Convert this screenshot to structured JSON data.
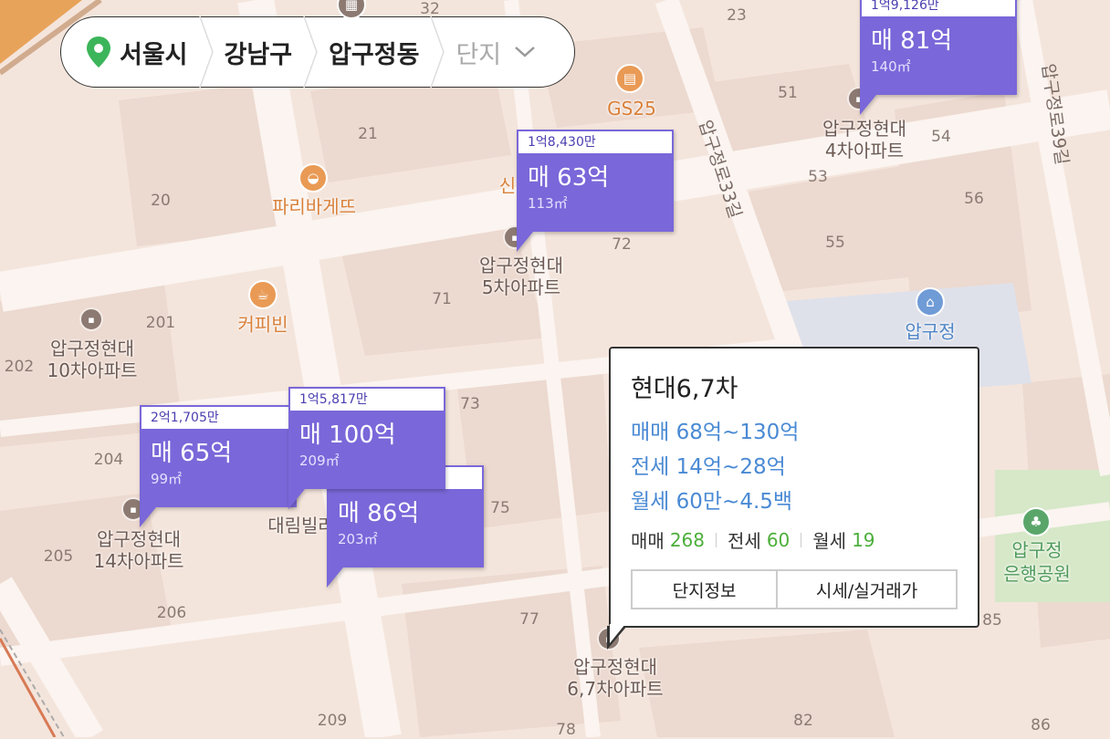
{
  "breadcrumb": {
    "city": "서울시",
    "district": "강남구",
    "dong": "압구정동",
    "complex_placeholder": "단지"
  },
  "block_numbers": {
    "n32": "32",
    "n23": "23",
    "n21": "21",
    "n20": "20",
    "n51": "51",
    "n54": "54",
    "n53": "53",
    "n56": "56",
    "n55": "55",
    "n72": "72",
    "n71": "71",
    "n201": "201",
    "n202": "202",
    "n73": "73",
    "n204": "204",
    "n75": "75",
    "n205": "205",
    "n206": "206",
    "n77": "77",
    "n85": "85",
    "n209": "209",
    "n82": "82",
    "n86": "86",
    "n78": "78"
  },
  "roads": {
    "apgujeong_ro_33": "압구정로33길",
    "apgujeong_ro_39": "압구정로39길"
  },
  "pois": {
    "gs25": "GS25",
    "paris": "파리바게뜨",
    "coffeebean": "커피빈",
    "apgujeong_office": "압구정",
    "park_line1": "압구정",
    "park_line2": "은행공원",
    "partial_sin": "신",
    "daerim": "대림빌라"
  },
  "buildings": {
    "b4_l1": "압구정현대",
    "b4_l2": "4차아파트",
    "b5_l1": "압구정현대",
    "b5_l2": "5차아파트",
    "b10_l1": "압구정현대",
    "b10_l2": "10차아파트",
    "b14_l1": "압구정현대",
    "b14_l2": "14차아파트",
    "b67_l1": "압구정현대",
    "b67_l2": "6,7차아파트"
  },
  "markers": [
    {
      "per_pyeong": "1억9,126만",
      "price": "매 81억",
      "area": "140㎡"
    },
    {
      "per_pyeong": "1억8,430만",
      "price": "매 63억",
      "area": "113㎡"
    },
    {
      "per_pyeong": "2억1,705만",
      "price": "매 65억",
      "area": "99㎡"
    },
    {
      "per_pyeong": "1억5,817만",
      "price": "매 100억",
      "area": "209㎡"
    },
    {
      "per_pyeong": "",
      "price": "매 86억",
      "area": "203㎡"
    }
  ],
  "popup": {
    "title": "현대6,7차",
    "sale_range": "매매 68억~130억",
    "jeonse_range": "전세 14억~28억",
    "monthly_range": "월세 60만~4.5백",
    "sale_label": "매매",
    "sale_count": "268",
    "jeonse_label": "전세",
    "jeonse_count": "60",
    "monthly_label": "월세",
    "monthly_count": "19",
    "btn_info": "단지정보",
    "btn_price": "시세/실거래가"
  },
  "colors": {
    "marker": "#7a67d9",
    "map_bg": "#f4e5dc",
    "road": "#fbf4f0",
    "popup_range": "#4a8ad4",
    "popup_count": "#4caf3a",
    "location_pin": "#3cb55a"
  }
}
